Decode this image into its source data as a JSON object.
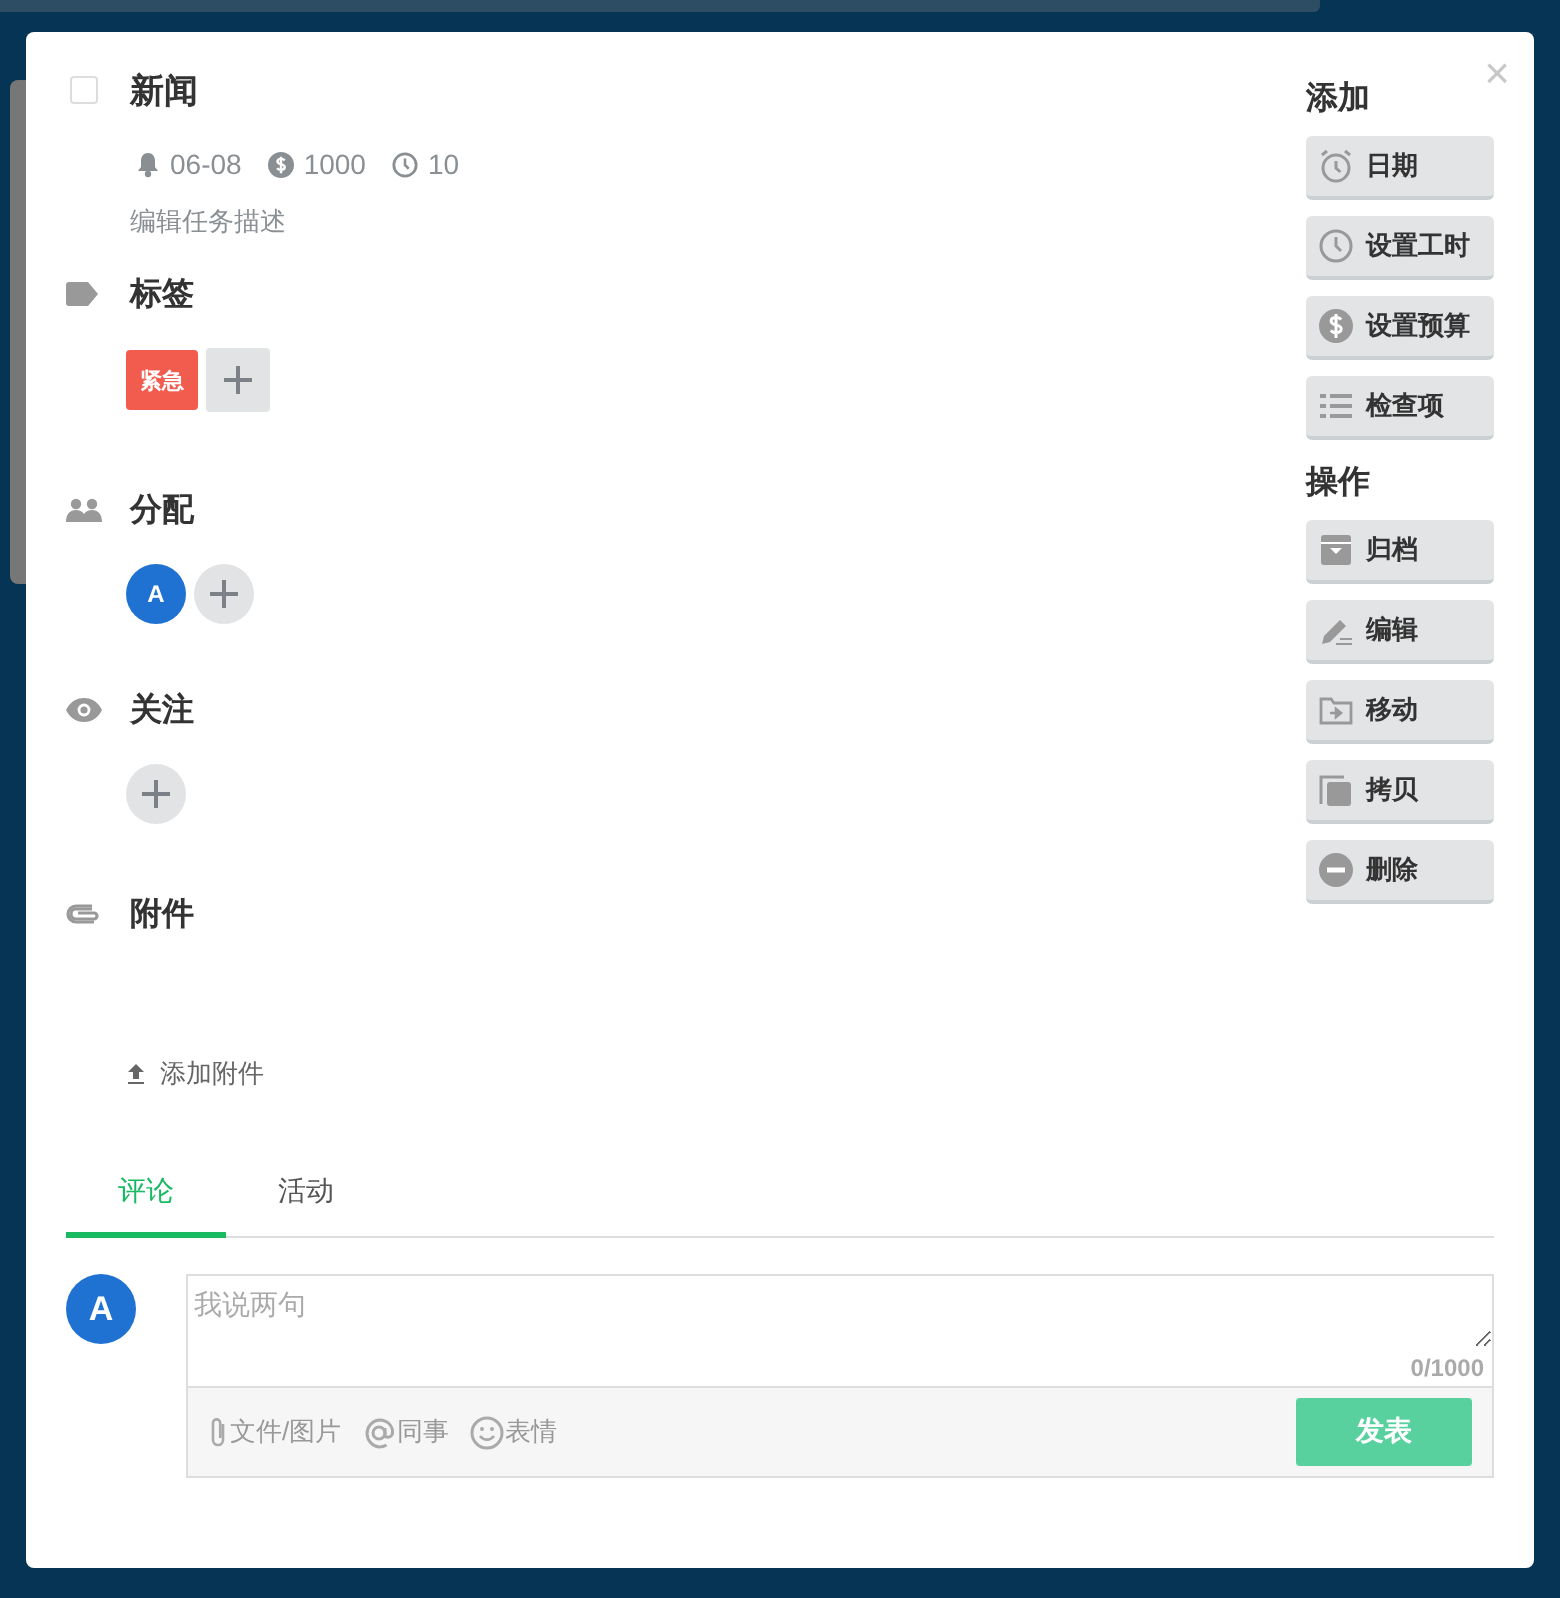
{
  "task": {
    "checked": false,
    "title": "新闻",
    "meta": [
      {
        "kind": "bell",
        "text": "06-08"
      },
      {
        "kind": "dollar",
        "text": "1000"
      },
      {
        "kind": "clock",
        "text": "10"
      }
    ],
    "description_placeholder": "编辑任务描述"
  },
  "sections": [
    {
      "kind": "tags",
      "title": "标签",
      "tags": [
        {
          "text": "紧急",
          "color": "#f25c4f"
        }
      ]
    },
    {
      "kind": "assign",
      "title": "分配",
      "avatars": [
        {
          "initial": "A",
          "color": "#1f72d2"
        }
      ]
    },
    {
      "kind": "watch",
      "title": "关注"
    },
    {
      "kind": "attach",
      "title": "附件",
      "upload": "添加附件"
    }
  ],
  "sidebar": [
    {
      "title": "添加",
      "buttons": [
        {
          "kind": "alarm",
          "label": "日期"
        },
        {
          "kind": "clock",
          "label": "设置工时"
        },
        {
          "kind": "dollar",
          "label": "设置预算"
        },
        {
          "kind": "list",
          "label": "检查项"
        }
      ]
    },
    {
      "title": "操作",
      "buttons": [
        {
          "kind": "archive",
          "label": "归档"
        },
        {
          "kind": "pencil",
          "label": "编辑"
        },
        {
          "kind": "folder",
          "label": "移动"
        },
        {
          "kind": "copy",
          "label": "拷贝"
        },
        {
          "kind": "minus",
          "label": "删除"
        }
      ]
    }
  ],
  "tabs": [
    {
      "label": "评论",
      "selected": true
    },
    {
      "label": "活动",
      "selected": false
    }
  ],
  "comment": {
    "avatar": "A",
    "placeholder": "我说两句",
    "counter": "0/1000",
    "tools": [
      {
        "kind": "clip",
        "label": "文件/图片"
      },
      {
        "kind": "at",
        "label": "同事"
      },
      {
        "kind": "smile",
        "label": "表情"
      }
    ],
    "submit": "发表"
  },
  "close": "×"
}
